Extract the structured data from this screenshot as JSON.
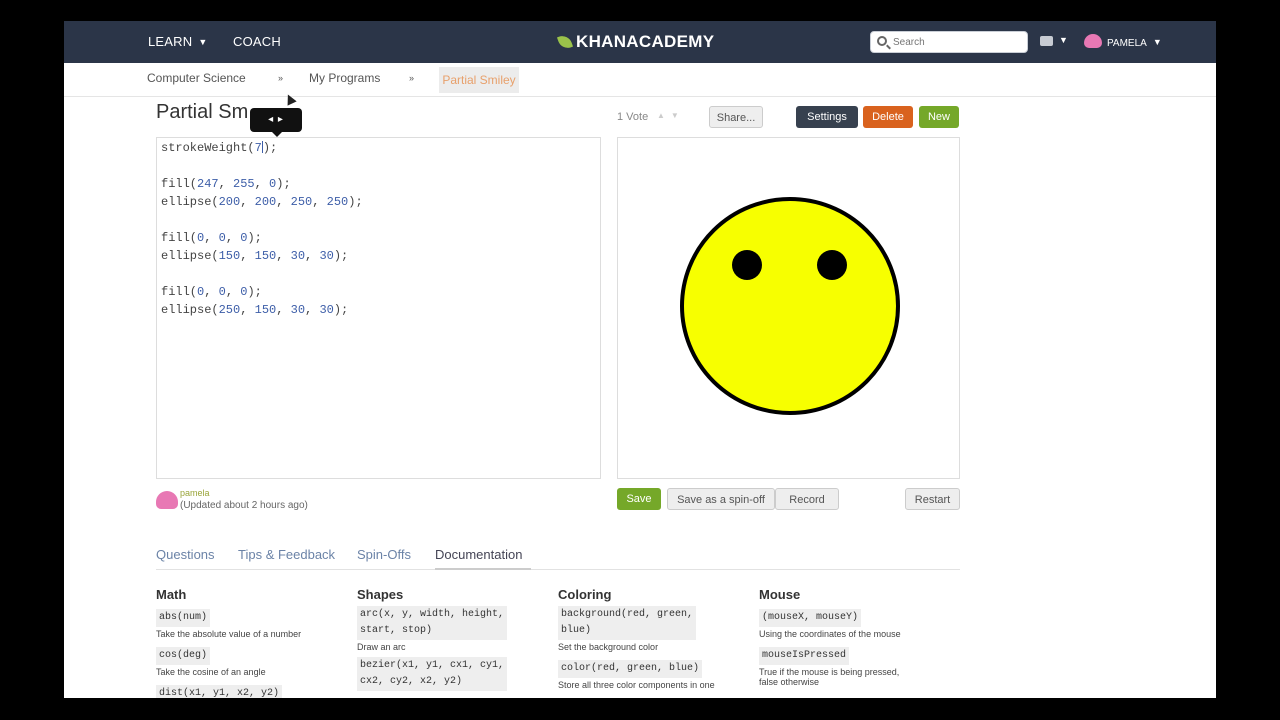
{
  "nav": {
    "learn": "LEARN",
    "coach": "COACH",
    "logo": "KHANACADEMY",
    "search_placeholder": "Search",
    "user": "PAMELA"
  },
  "breadcrumb": {
    "items": [
      "Computer Science",
      "My Programs",
      "Partial Smiley"
    ],
    "separator": "»"
  },
  "program": {
    "title": "Partial Sm",
    "tooltip": "◂ ▸",
    "votes": "1 Vote",
    "share": "Share...",
    "settings": "Settings",
    "delete": "Delete",
    "new": "New"
  },
  "code": {
    "stroke_fn": "strokeWeight(",
    "stroke_val": "7",
    "stroke_end": ");",
    "fill1": [
      "247",
      "255",
      "0"
    ],
    "ellipse1": [
      "200",
      "200",
      "250",
      "250"
    ],
    "fill2": [
      "0",
      "0",
      "0"
    ],
    "ellipse2": [
      "150",
      "150",
      "30",
      "30"
    ],
    "fill3": [
      "0",
      "0",
      "0"
    ],
    "ellipse3": [
      "250",
      "150",
      "30",
      "30"
    ]
  },
  "canvas": {
    "face_color": "#f7ff00",
    "eye_color": "#000000",
    "stroke_color": "#000000"
  },
  "actions": {
    "save": "Save",
    "spin_off": "Save as a spin-off",
    "record": "Record",
    "restart": "Restart"
  },
  "author": {
    "name": "pamela",
    "updated": "(Updated about 2 hours ago)"
  },
  "tabs": [
    "Questions",
    "Tips & Feedback",
    "Spin-Offs",
    "Documentation"
  ],
  "docs": {
    "math": {
      "title": "Math",
      "items": [
        {
          "code": "abs(num)",
          "desc": "Take the absolute value of a number"
        },
        {
          "code": "cos(deg)",
          "desc": "Take the cosine of an angle"
        },
        {
          "code": "dist(x1, y1, x2, y2)",
          "desc": ""
        }
      ]
    },
    "shapes": {
      "title": "Shapes",
      "items": [
        {
          "code": "arc(x, y, width, height,\nstart, stop)",
          "desc": "Draw an arc"
        },
        {
          "code": "bezier(x1, y1, cx1, cy1,\ncx2, cy2, x2, y2)",
          "desc": ""
        }
      ]
    },
    "coloring": {
      "title": "Coloring",
      "items": [
        {
          "code": "background(red, green,\nblue)",
          "desc": "Set the background color"
        },
        {
          "code": "color(red, green, blue)",
          "desc": "Store all three color components in one"
        }
      ]
    },
    "mouse": {
      "title": "Mouse",
      "items": [
        {
          "code": "(mouseX, mouseY)",
          "desc": "Using the coordinates of the mouse"
        },
        {
          "code": "mouseIsPressed",
          "desc": "True if the mouse is being pressed,\nfalse otherwise"
        }
      ]
    }
  }
}
